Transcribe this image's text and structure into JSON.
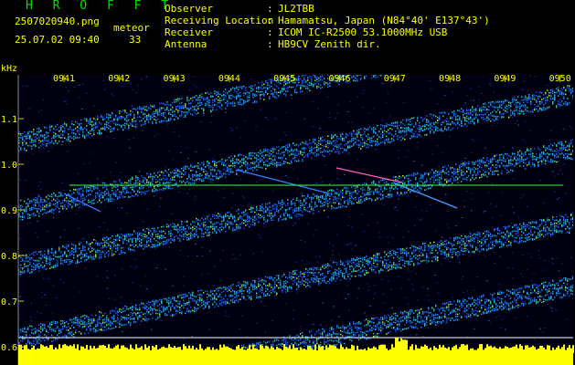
{
  "header": {
    "app_title": "H R O F F T",
    "filename": "2507020940.png",
    "datetime": "25.07.02 09:40",
    "meteor_label": "meteor",
    "meteor_count": "33"
  },
  "station_info": [
    {
      "label": "Observer",
      "value": "JL2TBB"
    },
    {
      "label": "Receiving Location",
      "value": "Hamamatsu, Japan (N84°40' E137°43')"
    },
    {
      "label": "Receiver",
      "value": "ICOM IC-R2500 53.1000MHz USB"
    },
    {
      "label": "Antenna",
      "value": "HB9CV Zenith dir."
    }
  ],
  "axis": {
    "y_unit": "kHz",
    "y_ticks": [
      "1.1",
      "1.0",
      "0.9",
      "0.8",
      "0.7",
      "0.6"
    ],
    "x_ticks": [
      "0941",
      "0942",
      "0943",
      "0944",
      "0945",
      "0946",
      "0947",
      "0948",
      "0949",
      "0950"
    ]
  },
  "colors": {
    "background": "#000000",
    "title": "#00e000",
    "text": "#ffff00",
    "signal_band": "#1a4fd0",
    "ref_line": "#40ff40",
    "baseline": "#ffffff",
    "histogram": "#ffff00"
  }
}
